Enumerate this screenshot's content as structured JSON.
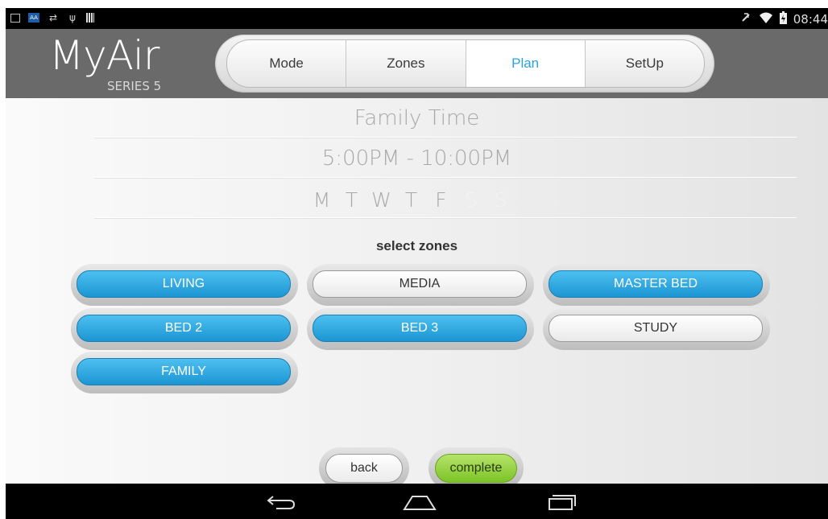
{
  "status_bar": {
    "time": "08:44",
    "left_icons": [
      "image-icon",
      "aa-icon",
      "swap-icon",
      "usb-icon",
      "barcode-icon"
    ],
    "right_icons": [
      "mute-icon",
      "wifi-icon",
      "battery-icon"
    ]
  },
  "header": {
    "logo": "MyAir",
    "logo_sub": "SERIES 5",
    "tabs": [
      {
        "label": "Mode",
        "active": false
      },
      {
        "label": "Zones",
        "active": false
      },
      {
        "label": "Plan",
        "active": true
      },
      {
        "label": "SetUp",
        "active": false
      }
    ]
  },
  "plan": {
    "name": "Family Time",
    "time": "5:00PM - 10:00PM",
    "days": [
      {
        "label": "M",
        "enabled": true
      },
      {
        "label": "T",
        "enabled": true
      },
      {
        "label": "W",
        "enabled": true
      },
      {
        "label": "T",
        "enabled": true
      },
      {
        "label": "F",
        "enabled": true
      },
      {
        "label": "S",
        "enabled": false
      },
      {
        "label": "S",
        "enabled": false
      }
    ]
  },
  "zones": {
    "title": "select zones",
    "items": [
      {
        "label": "LIVING",
        "selected": true
      },
      {
        "label": "MEDIA",
        "selected": false
      },
      {
        "label": "MASTER BED",
        "selected": true
      },
      {
        "label": "BED 2",
        "selected": true
      },
      {
        "label": "BED 3",
        "selected": true
      },
      {
        "label": "STUDY",
        "selected": false
      },
      {
        "label": "FAMILY",
        "selected": true
      }
    ]
  },
  "actions": {
    "back": "back",
    "complete": "complete"
  },
  "colors": {
    "active_tab": "#2aa2dc",
    "zone_on": "#2aa2dc",
    "complete_green": "#8fd034",
    "header_bg": "#6a6a6a"
  },
  "system_nav": [
    "back-icon",
    "home-icon",
    "recents-icon"
  ]
}
